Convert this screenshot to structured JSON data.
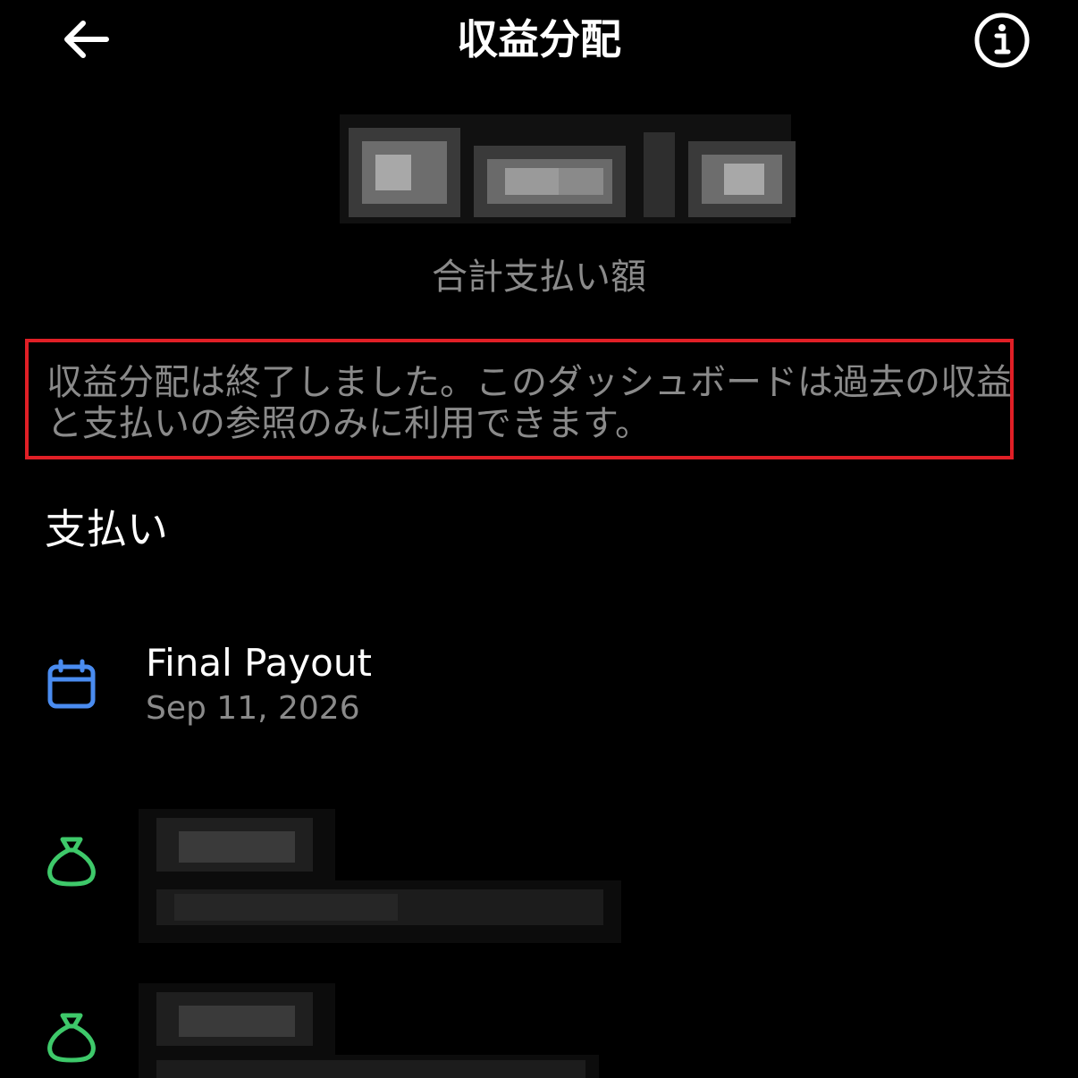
{
  "header": {
    "title": "収益分配",
    "back_icon": "arrow-left-icon",
    "info_icon": "info-circle-icon"
  },
  "summary": {
    "amount_caption": "合計支払い額"
  },
  "notice": {
    "text": "収益分配は終了しました。このダッシュボードは過去の収益と支払いの参照のみに利用できます。",
    "border_color": "#e01f26"
  },
  "payouts": {
    "section_title": "支払い",
    "items": [
      {
        "icon": "calendar-icon",
        "icon_color": "#4a8cf0",
        "title": "Final Payout",
        "date": "Sep 11, 2026"
      },
      {
        "icon": "money-bag-icon",
        "icon_color": "#3ec96a"
      },
      {
        "icon": "money-bag-icon",
        "icon_color": "#3ec96a"
      }
    ]
  }
}
